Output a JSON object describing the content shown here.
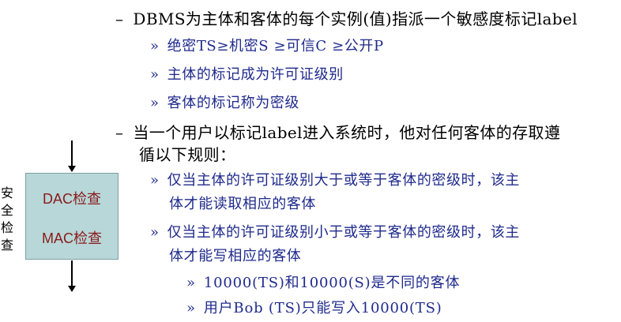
{
  "bullets": {
    "l1_1": {
      "marker": "–",
      "text": "DBMS为主体和客体的每个实例(值)指派一个敏感度标记label"
    },
    "l2_1": {
      "marker": "»",
      "text": "绝密TS≥机密S ≥可信C ≥公开P"
    },
    "l2_2": {
      "marker": "»",
      "text": "主体的标记成为许可证级别"
    },
    "l2_3": {
      "marker": "»",
      "text": "客体的标记称为密级"
    },
    "l1_2": {
      "marker": "–",
      "text_a": "当一个用户以标记label进入系统时，他对任何客体的存取遵",
      "text_b": "循以下规则："
    },
    "l2_4": {
      "marker": "»",
      "text_a": "仅当主体的许可证级别大于或等于客体的密级时，该主",
      "text_b": "体才能读取相应的客体"
    },
    "l2_5": {
      "marker": "»",
      "text_a": "仅当主体的许可证级别小于或等于客体的密级时，该主",
      "text_b": "体才能写相应的客体"
    },
    "l3_1": {
      "marker": "»",
      "text": "10000(TS)和10000(S)是不同的客体"
    },
    "l3_2": {
      "marker": "»",
      "text": "用户Bob (TS)只能写入10000(TS)"
    }
  },
  "side": {
    "label": "安全检查",
    "checks": [
      "DAC检查",
      "MAC检查"
    ]
  },
  "colors": {
    "blue_text": "#1f2a8c",
    "box_fill": "#b7d7d8",
    "check_text": "#8b1a1a"
  }
}
